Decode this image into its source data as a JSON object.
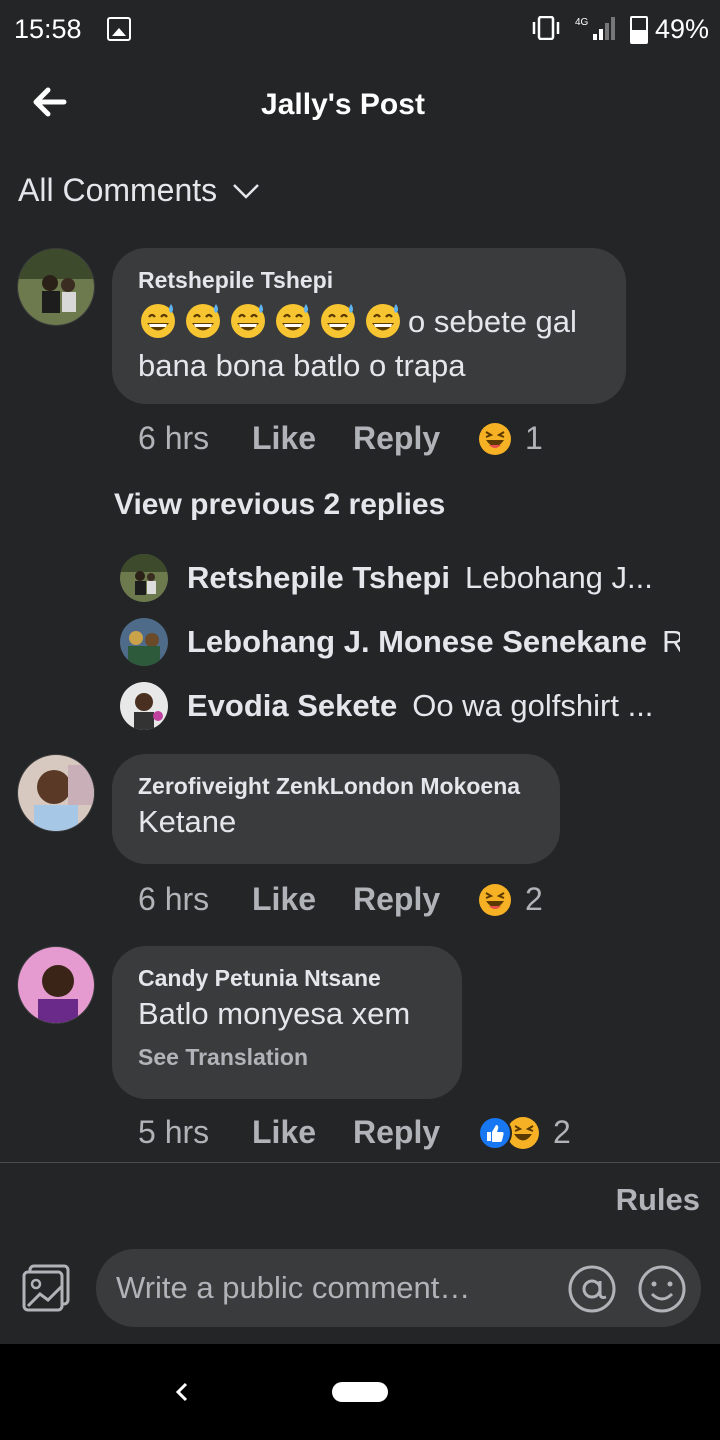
{
  "status_bar": {
    "time": "15:58",
    "network": "4G",
    "battery": "49%",
    "battery_level": 0.49
  },
  "header": {
    "title": "Jally's Post",
    "back_icon": "arrow-left-icon"
  },
  "filter": {
    "label": "All Comments"
  },
  "comments": [
    {
      "author": "Retshepile Tshepi",
      "emoji_count": 6,
      "text": "o sebete gal bana bona batlo o trapa",
      "time": "6 hrs",
      "like": "Like",
      "reply": "Reply",
      "reaction_count": "1"
    },
    {
      "author": "Zerofiveight ZenkLondon Mokoena",
      "text": "Ketane",
      "time": "6 hrs",
      "like": "Like",
      "reply": "Reply",
      "reaction_count": "2"
    },
    {
      "author": "Candy Petunia Ntsane",
      "text": "Batlo monyesa xem",
      "see_translation": "See Translation",
      "time": "5 hrs",
      "like": "Like",
      "reply": "Reply",
      "reaction_count": "2"
    }
  ],
  "replies": {
    "view_previous": "View previous 2 replies",
    "items": [
      {
        "name": "Retshepile Tshepi",
        "text": "Lebohang J..."
      },
      {
        "name": "Lebohang J. Monese Senekane",
        "text": "R"
      },
      {
        "name": "Evodia Sekete",
        "text": "Oo wa golfshirt ..."
      }
    ]
  },
  "footer": {
    "rules": "Rules",
    "composer_placeholder": "Write a public comment…"
  },
  "colors": {
    "background": "#242526",
    "bubble": "#3a3b3c",
    "text": "#e4e6eb",
    "secondary": "#b0b3b8",
    "like_blue": "#1877f2",
    "haha_yellow": "#f7b125"
  }
}
